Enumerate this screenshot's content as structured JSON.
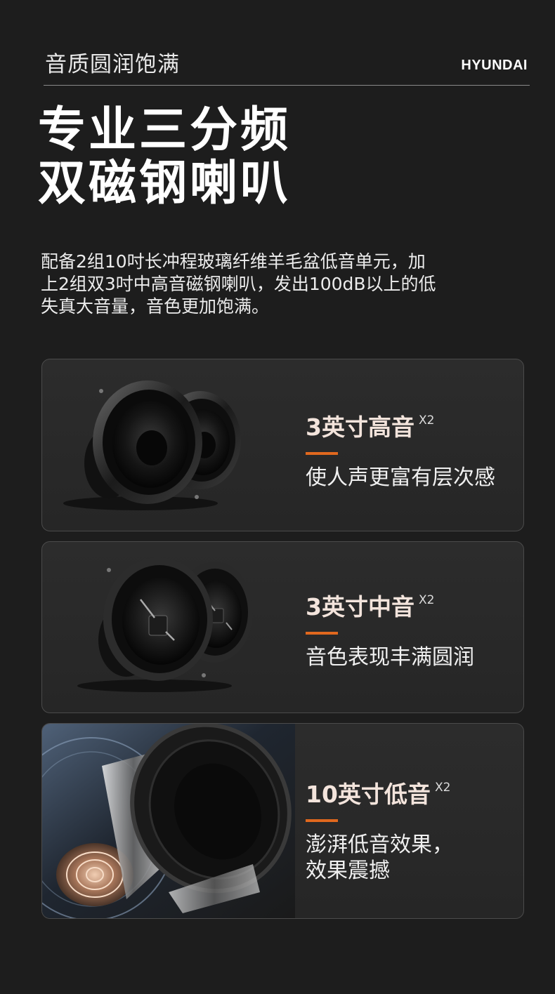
{
  "header": {
    "tagline": "音质圆润饱满",
    "brand": "HYUNDAI"
  },
  "headline": {
    "line1": "专业三分频",
    "line2": "双磁钢喇叭"
  },
  "intro": {
    "line1": "配备2组10吋长冲程玻璃纤维羊毛盆低音单元，加",
    "line2": "上2组双3吋中高音磁钢喇叭，发出100dB以上的低",
    "line3": "失真大音量，音色更加饱满。"
  },
  "cards": [
    {
      "title": "3英寸高音",
      "qty": "X2",
      "desc1": "使人声更富有层次感",
      "image": "two-tweeter-speakers"
    },
    {
      "title": "3英寸中音",
      "qty": "X2",
      "desc1": "音色表现丰满圆润",
      "image": "two-midrange-speakers"
    },
    {
      "title": "10英寸低音",
      "qty": "X2",
      "desc1": "澎湃低音效果，",
      "desc2": "效果震撼",
      "image": "woofer-cutaway"
    }
  ],
  "colors": {
    "background": "#1d1d1d",
    "accent": "#e0681e",
    "card_border": "#4b4b4b"
  }
}
